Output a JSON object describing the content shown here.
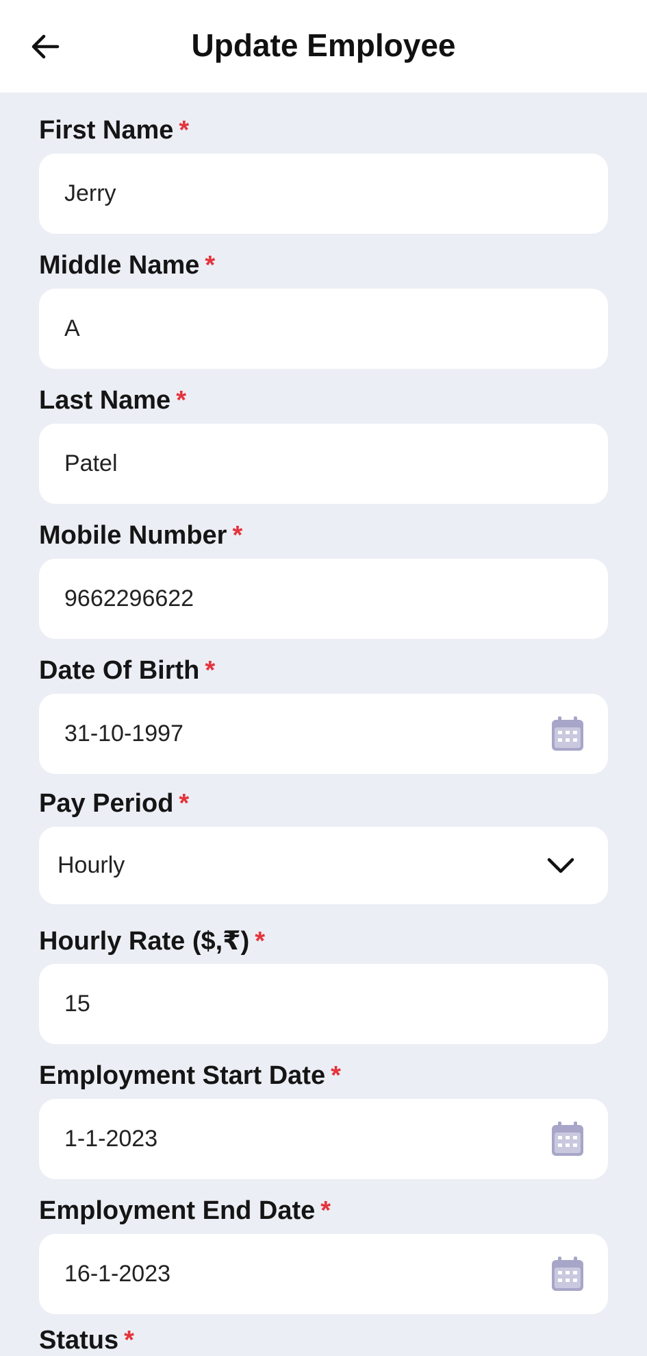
{
  "header": {
    "title": "Update Employee",
    "back_icon": "arrow-left-icon"
  },
  "required_marker": "*",
  "fields": [
    {
      "label": "First Name",
      "value": "Jerry",
      "type": "text"
    },
    {
      "label": "Middle Name",
      "value": "A",
      "type": "text"
    },
    {
      "label": "Last Name",
      "value": "Patel",
      "type": "text"
    },
    {
      "label": "Mobile Number",
      "value": "9662296622",
      "type": "text"
    },
    {
      "label": "Date Of Birth",
      "value": "31-10-1997",
      "type": "date",
      "icon": "calendar-icon"
    },
    {
      "label": "Pay Period",
      "value": "Hourly",
      "type": "select",
      "icon": "chevron-down-icon"
    },
    {
      "label": "Hourly Rate ($,₹)",
      "value": "15",
      "type": "text"
    },
    {
      "label": "Employment Start Date",
      "value": "1-1-2023",
      "type": "date",
      "icon": "calendar-icon"
    },
    {
      "label": "Employment End Date",
      "value": "16-1-2023",
      "type": "date",
      "icon": "calendar-icon"
    },
    {
      "label": "Status",
      "type": "select"
    }
  ],
  "colors": {
    "background": "#eceef5",
    "field_background": "#ffffff",
    "required": "#e5333b",
    "icon": "#a7a6c8"
  }
}
